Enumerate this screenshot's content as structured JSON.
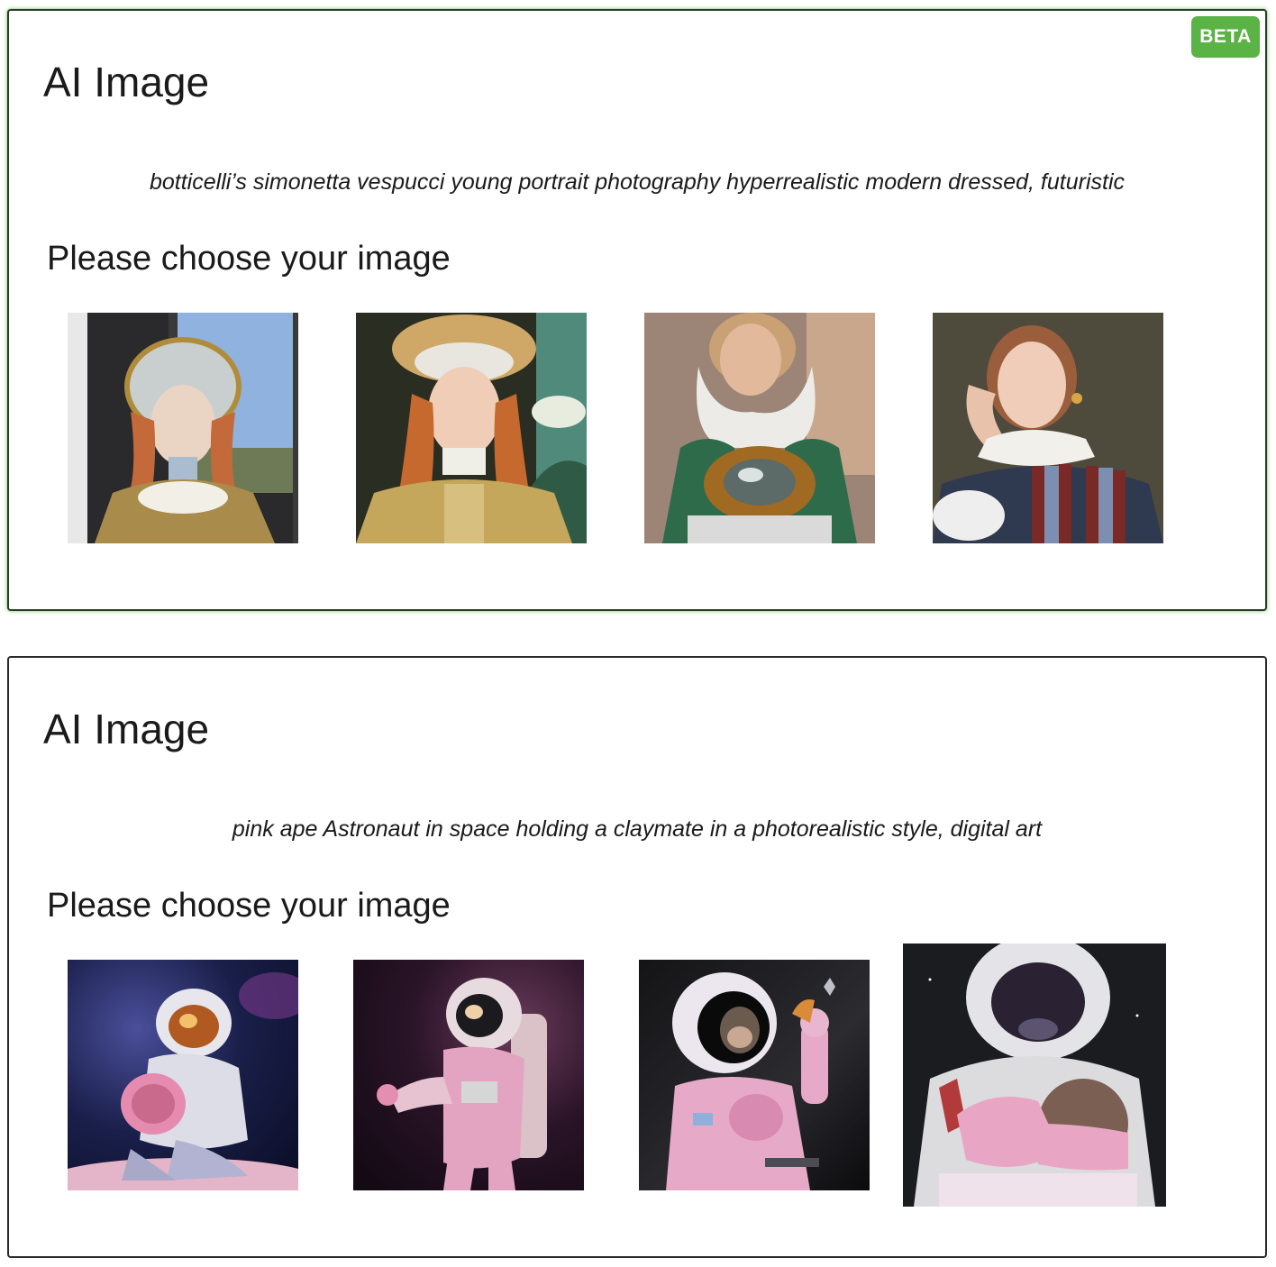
{
  "badge": {
    "label": "BETA",
    "color": "#5ab344"
  },
  "cards": [
    {
      "title": "AI Image",
      "prompt": "botticelli’s simonetta vespucci young portrait photography hyperrealistic modern dressed, futuristic",
      "subheading": "Please choose your image",
      "selected": true,
      "images": [
        {
          "subject": "renaissance-girl-portrait-window"
        },
        {
          "subject": "renaissance-girl-portrait-landscape"
        },
        {
          "subject": "renaissance-girl-futuristic-armor"
        },
        {
          "subject": "renaissance-girl-striped-dress"
        }
      ]
    },
    {
      "title": "AI Image",
      "prompt": "pink ape Astronaut in space holding a claymate in a photorealistic style, digital art",
      "subheading": "Please choose your image",
      "selected": false,
      "images": [
        {
          "subject": "pink-astronaut-kneeling-holding-planet"
        },
        {
          "subject": "pink-astronaut-standing-nebula"
        },
        {
          "subject": "pink-ape-astronaut-holding-tool"
        },
        {
          "subject": "pink-astronaut-closeup-holding-ball"
        }
      ]
    }
  ]
}
